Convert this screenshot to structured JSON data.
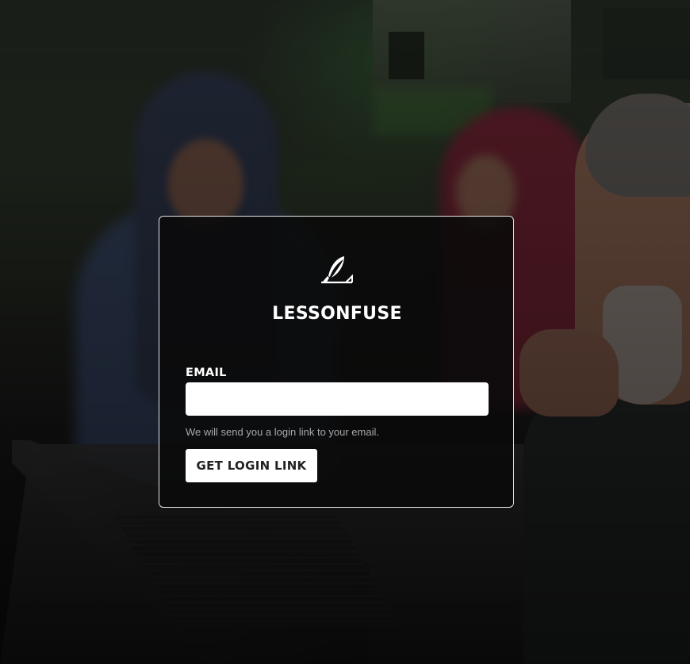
{
  "app": {
    "brand_name": "LESSONFUSE",
    "logo_icon": "quill-pen-icon"
  },
  "login_form": {
    "email_label": "EMAIL",
    "email_value": "",
    "email_placeholder": "",
    "help_text": "We will send you a login link to your email.",
    "submit_label": "GET LOGIN LINK"
  },
  "colors": {
    "card_background": "#0a0a0a",
    "card_border": "#e6e6e6",
    "text_primary": "#ffffff",
    "text_muted": "#a9a9a9",
    "button_background": "#ffffff",
    "button_text": "#222222"
  }
}
